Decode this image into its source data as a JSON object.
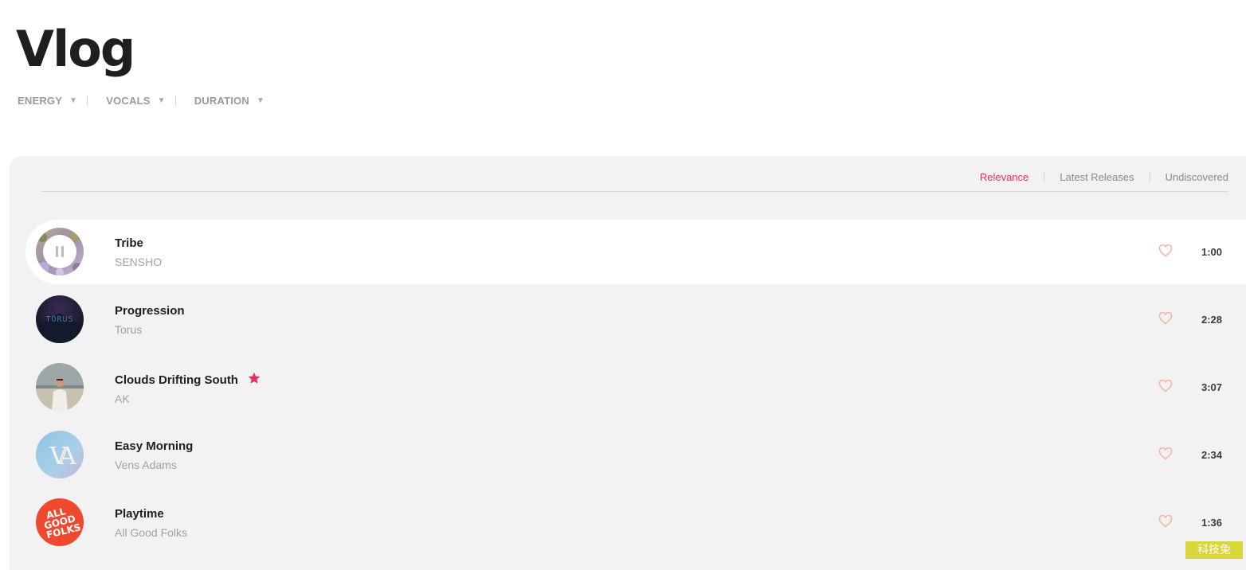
{
  "page": {
    "title": "Vlog"
  },
  "filters": [
    {
      "label": "ENERGY"
    },
    {
      "label": "VOCALS"
    },
    {
      "label": "DURATION"
    }
  ],
  "sort": {
    "options": [
      {
        "label": "Relevance",
        "active": true
      },
      {
        "label": "Latest Releases",
        "active": false
      },
      {
        "label": "Undiscovered",
        "active": false
      }
    ]
  },
  "tracks": [
    {
      "title": "Tribe",
      "artist": "SENSHO",
      "duration": "1:00",
      "playing": true,
      "featured": false
    },
    {
      "title": "Progression",
      "artist": "Torus",
      "duration": "2:28",
      "playing": false,
      "featured": false
    },
    {
      "title": "Clouds Drifting South",
      "artist": "AK",
      "duration": "3:07",
      "playing": false,
      "featured": true
    },
    {
      "title": "Easy Morning",
      "artist": "Vens Adams",
      "duration": "2:34",
      "playing": false,
      "featured": false
    },
    {
      "title": "Playtime",
      "artist": "All Good Folks",
      "duration": "1:36",
      "playing": false,
      "featured": false
    }
  ],
  "covers": {
    "torus_text": "TORUS",
    "vens_adams_text": "VA",
    "all_good_folks_text": [
      "ALL",
      "GOOD",
      "FOLKS"
    ]
  },
  "watermark": {
    "text": "科技兔"
  },
  "colors": {
    "accent": "#e8325a",
    "heart": "#f3b7a8",
    "panel_bg": "#f2f2f2",
    "title": "#1f1f1f",
    "muted": "#a2a2a2"
  },
  "icons": {
    "filter_caret": "▼"
  }
}
